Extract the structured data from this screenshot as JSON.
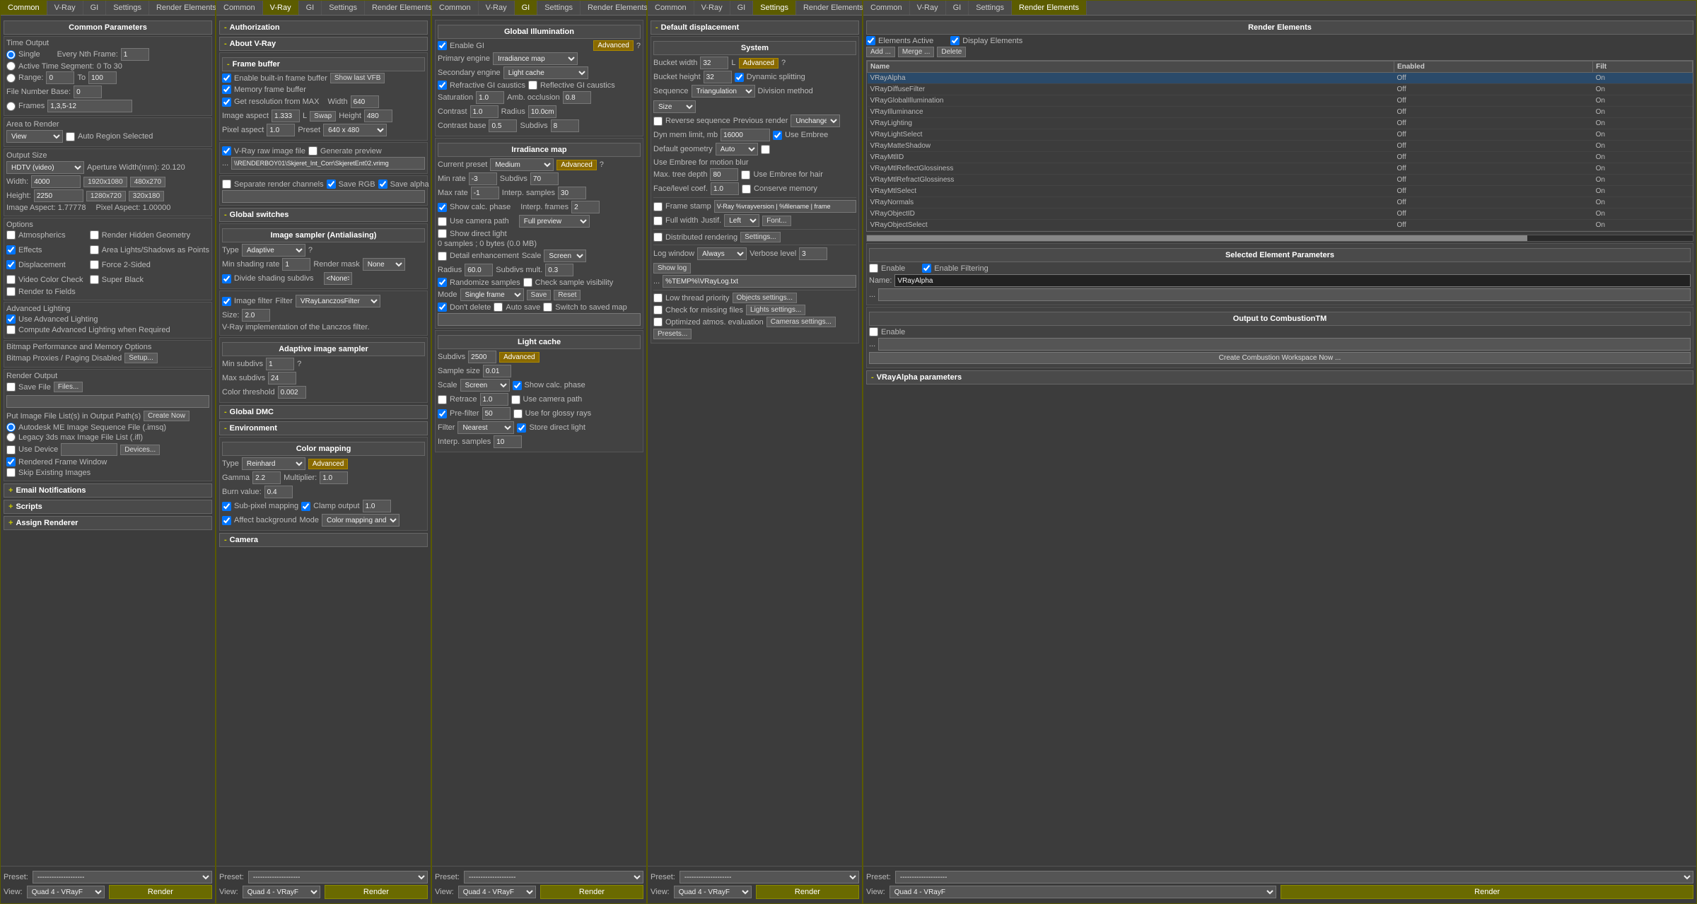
{
  "panels": [
    {
      "id": "panel1",
      "tabs": [
        "Common",
        "V-Ray",
        "GI",
        "Settings",
        "Render Elements"
      ],
      "activeTab": "Common",
      "sections": {
        "title": "Common Parameters",
        "timeOutput": {
          "label": "Time Output",
          "options": [
            {
              "label": "Single",
              "extra": "Every Nth Frame:",
              "value": "1"
            },
            {
              "label": "Active Time Segment:",
              "value": "0 To 30"
            },
            {
              "label": "Range:",
              "from": "0",
              "to": "100"
            },
            {
              "label": "File Number Base:",
              "value": "0"
            },
            {
              "label": "Frames",
              "value": "1,3,5-12"
            }
          ]
        },
        "areaToRender": {
          "label": "Area to Render",
          "view": "View",
          "autoRegion": "Auto Region Selected"
        },
        "outputSize": {
          "label": "Output Size",
          "preset": "HDTV (video)",
          "aperture": "Aperture Width(mm): 20.120",
          "width": "4000",
          "widthOptions": "1920x1080    480x270",
          "height": "2250",
          "heightOptions": "1280x720    320x180",
          "imageAspect": "1.77778",
          "pixelAspect": "1.00000"
        },
        "options": {
          "label": "Options",
          "items": [
            {
              "label": "Atmospherics",
              "checked": false
            },
            {
              "label": "Render Hidden Geometry",
              "checked": false
            },
            {
              "label": "Effects",
              "checked": true
            },
            {
              "label": "Area Lights/Shadows as Points",
              "checked": false
            },
            {
              "label": "Displacement",
              "checked": true
            },
            {
              "label": "Force 2-Sided",
              "checked": false
            },
            {
              "label": "Video Color Check",
              "checked": false
            },
            {
              "label": "Super Black",
              "checked": false
            },
            {
              "label": "Render to Fields",
              "checked": false
            }
          ]
        },
        "advancedLighting": {
          "label": "Advanced Lighting",
          "items": [
            {
              "label": "Use Advanced Lighting",
              "checked": true
            },
            {
              "label": "Compute Advanced Lighting when Required",
              "checked": false
            }
          ]
        },
        "bitmapPerf": {
          "label": "Bitmap Performance and Memory Options",
          "proxies": "Bitmap Proxies / Paging Disabled",
          "setupBtn": "Setup..."
        },
        "renderOutput": {
          "label": "Render Output",
          "saveFile": "Save File",
          "filesBtn": "Files...",
          "putImage": "Put Image File List(s) in Output Path(s)",
          "createNow": "Create Now",
          "autodesk": "Autodesk ME Image Sequence File (.imsq)",
          "legacy": "Legacy 3ds max Image File List (.ifl)",
          "useDevice": "Use Device",
          "devicesBtn": "Devices...",
          "renderedFrameWindow": "Rendered Frame Window",
          "skipExisting": "Skip Existing Images"
        },
        "email": "Email Notifications",
        "scripts": "Scripts",
        "assignRenderer": "Assign Renderer"
      },
      "footer": {
        "presetLabel": "Preset:",
        "presetValue": "--------------------",
        "viewLabel": "View:",
        "viewValue": "Quad 4 - VRayF",
        "renderBtn": "Render"
      }
    },
    {
      "id": "panel2",
      "tabs": [
        "Common",
        "V-Ray",
        "GI",
        "Settings",
        "Render Elements"
      ],
      "activeTab": "V-Ray",
      "sections": {
        "authorization": "Authorization",
        "aboutVRay": "About V-Ray",
        "frameBuffer": {
          "label": "Frame buffer",
          "items": [
            {
              "label": "Enable built-in frame buffer",
              "checked": true
            },
            {
              "label": "Memory frame buffer",
              "checked": true
            }
          ],
          "showLastVFB": "Show last VFB",
          "getResFromMax": "Get resolution from MAX",
          "widthLabel": "Width",
          "widthVal": "640",
          "heightLabel": "Height",
          "heightVal": "480",
          "swapBtn": "Swap",
          "imageAspect": "1.333",
          "pixelAspect": "1.0",
          "presetLabel": "Preset",
          "presetVal": "640 x 480",
          "lLabel": "L"
        },
        "rawImageFile": {
          "label": "V-Ray raw image file",
          "checked": true,
          "generatePreview": "Generate preview",
          "path": "\\\\RENDERBOY01\\Skjeret_Int_Corr\\SkjeretEnt02.vrimg"
        },
        "separateChannels": {
          "label": "Separate render channels",
          "checked": false,
          "saveRGB": "Save RGB",
          "saveAlpha": "Save alpha",
          "saveRGBChecked": true,
          "saveAlphaChecked": true
        },
        "globalSwitches": "Global switches",
        "imageSampler": {
          "label": "Image sampler (Antialiasing)",
          "typeLabel": "Type",
          "typeVal": "Adaptive",
          "minShadingRate": "1",
          "renderMask": "None",
          "divideShadingSubdivs": "Divide shading subdivs",
          "divideShadingSubdivsChecked": true,
          "noneVal": "<None>"
        },
        "imageFilter": {
          "label": "Image filter",
          "checked": true,
          "filterLabel": "Filter",
          "filterVal": "VRayLanczosFilter",
          "sizeLabel": "Size",
          "sizeVal": "2.0",
          "description": "V-Ray implementation of the Lanczos filter."
        },
        "adaptiveSampler": {
          "label": "Adaptive image sampler",
          "minSubdivs": "1",
          "maxSubdivs": "24",
          "colorThreshold": "0.002"
        },
        "globalDMC": "Global DMC",
        "environment": "Environment",
        "colorMapping": {
          "label": "Color mapping",
          "typeLabel": "Type",
          "typeVal": "Reinhard",
          "advancedBtn": "Advanced",
          "gammaLabel": "Gamma",
          "gammaVal": "2.2",
          "multiplierLabel": "Multiplier:",
          "multiplierVal": "1.0",
          "burnLabel": "Burn value:",
          "burnVal": "0.4",
          "subPixel": "Sub-pixel mapping",
          "subPixelChecked": true,
          "clampOutput": "Clamp output",
          "clampVal": "1.0",
          "affectBg": "Affect background",
          "affectBgChecked": true,
          "modeLabel": "Mode",
          "modeVal": "Color mapping and g"
        },
        "camera": "Camera"
      },
      "footer": {
        "presetLabel": "Preset:",
        "presetValue": "--------------------",
        "viewLabel": "View:",
        "viewValue": "Quad 4 - VRayF",
        "renderBtn": "Render"
      }
    },
    {
      "id": "panel3",
      "tabs": [
        "Common",
        "V-Ray",
        "GI",
        "Settings",
        "Render Elements"
      ],
      "activeTab": "GI",
      "sections": {
        "globalIllumination": {
          "label": "Global Illumination",
          "enableGI": "Enable GI",
          "enableGIChecked": true,
          "advancedBtn": "Advanced",
          "primaryLabel": "Primary engine",
          "primaryVal": "Irradiance map",
          "secondaryLabel": "Secondary engine",
          "secondaryVal": "Light cache",
          "refractiveGI": "Refractive GI caustics",
          "refractiveChecked": true,
          "reflectiveGI": "Reflective GI caustics",
          "reflectiveChecked": false,
          "saturationLabel": "Saturation",
          "saturationVal": "1.0",
          "ambOcclLabel": "Amb. occlusion",
          "ambOcclVal": "0.8",
          "contrastLabel": "Contrast",
          "contrastVal": "1.0",
          "radiusLabel": "Radius",
          "radiusVal": "10.0cm",
          "contrastBaseLabel": "Contrast base",
          "contrastBaseVal": "0.5",
          "subdivsLabel": "Subdivs",
          "subdivsVal": "8"
        },
        "irradianceMap": {
          "label": "Irradiance map",
          "currentPreset": "Medium",
          "advancedBtn": "Advanced",
          "minRate": "-3",
          "maxRate": "-1",
          "subdivs": "70",
          "interpSamples": "30",
          "showCalcPhase": "Show calc. phase",
          "showCalcPhaseChecked": true,
          "useCamera": "Use camera path",
          "useCameraChecked": false,
          "showDirect": "Show direct light",
          "showDirectChecked": false,
          "interpFrames": "2",
          "fullPreview": "Full preview",
          "bytes": "0 samples ; 0 bytes (0.0 MB)",
          "detailEnhancement": "Detail enhancement",
          "detailChecked": false,
          "scaleLabel": "Scale",
          "scaleVal": "Screen",
          "radiusLabel": "Radius",
          "radiusVal": "60.0",
          "subdivsMult": "Subdivs mult.",
          "subdivsMultVal": "0.3",
          "randomizeSamples": "Randomize samples",
          "randomizeChecked": true,
          "checkSampleVisibility": "Check sample visibility",
          "checkChecked": false,
          "mode": "Single frame",
          "saveBtn": "Save",
          "resetBtn": "Reset",
          "dontDelete": "Don't delete",
          "dontDeleteChecked": true,
          "autoSave": "Auto save",
          "autoSaveChecked": false,
          "switchToSaved": "Switch to saved map",
          "switchChecked": false
        },
        "lightCache": {
          "label": "Light cache",
          "subdivs": "2500",
          "advancedBtn": "Advanced",
          "sampleSize": "0.01",
          "scaleLabel": "Scale",
          "scaleVal": "Screen",
          "showCalcPhase": "Show calc. phase",
          "showCalcPhaseChecked": true,
          "retrace": "Retrace",
          "retraceChecked": false,
          "retraceVal": "1.0",
          "useCameraPath": "Use camera path",
          "useCameraPathChecked": false,
          "preFilter": "Pre-filter",
          "preFilterChecked": true,
          "preFilterVal": "50",
          "useGlossyRays": "Use for glossy rays",
          "useGlossyChecked": false,
          "filterLabel": "Filter",
          "filterVal": "Nearest",
          "storeDirect": "Store direct light",
          "storeDirectChecked": true,
          "interpSamples": "10"
        }
      },
      "footer": {
        "presetLabel": "Preset:",
        "presetValue": "--------------------",
        "viewLabel": "View:",
        "viewValue": "Quad 4 - VRayF",
        "renderBtn": "Render"
      }
    },
    {
      "id": "panel4",
      "tabs": [
        "Common",
        "V-Ray",
        "GI",
        "Settings",
        "Render Elements"
      ],
      "activeTab": "Settings",
      "sections": {
        "defaultDisplacement": {
          "label": "Default displacement",
          "system": "System",
          "bucketWidthLabel": "Bucket width",
          "bucketWidthVal": "32",
          "lLabel": "L",
          "advancedBtn": "Advanced",
          "bucketHeightLabel": "Bucket height",
          "bucketHeightVal": "32",
          "dynamicSplitting": "Dynamic splitting",
          "dynamicChecked": true,
          "sequenceLabel": "Sequence",
          "sequenceVal": "Triangulation",
          "divMethodLabel": "Division method",
          "divMethodVal": "Size",
          "reverseSeq": "Reverse sequence",
          "reverseChecked": false,
          "prevRender": "Previous render",
          "prevRenderVal": "Unchange",
          "dynMemLabel": "Dyn mem limit, mb",
          "dynMemVal": "16000",
          "useEmbree": "Use Embree",
          "useEmbreeChecked": true,
          "defaultGeom": "Default geometry",
          "defaultGeomVal": "Auto",
          "embreeMotionBlur": "Use Embree for motion blur",
          "embreeMotionChecked": false,
          "maxTreeDepth": "Max. tree depth",
          "maxTreeVal": "80",
          "embreeHair": "Use Embree for hair",
          "embreeHairChecked": false,
          "faceLevelCoef": "Face/level coef.",
          "faceLevelVal": "1.0",
          "conserveMemory": "Conserve memory",
          "conserveChecked": false,
          "frameStamp": "Frame stamp",
          "frameStampVal": "V-Ray %vrayversion | %filename | frame",
          "fullWidth": "Full width",
          "justify": "Justif.",
          "justifyVal": "Left",
          "fontBtn": "Font...",
          "distributedRendering": "Distributed rendering",
          "distributedChecked": false,
          "settingsBtn": "Settings...",
          "logWindow": "Log window",
          "logWindowVal": "Always",
          "verboseLevel": "Verbose level",
          "verboseLevelVal": "3",
          "showLog": "Show log",
          "logPath": "%TEMP%\\VRayLog.txt",
          "lowThreadPriority": "Low thread priority",
          "lowThreadChecked": false,
          "objectsSettings": "Objects settings...",
          "checkMissingFiles": "Check for missing files",
          "checkMissingChecked": false,
          "lightsSettings": "Lights settings...",
          "optimizedAtmos": "Optimized atmos. evaluation",
          "optimizedChecked": false,
          "camerasSettings": "Cameras settings...",
          "presetsBtn": "Presets..."
        }
      },
      "footer": {
        "presetLabel": "Preset:",
        "presetValue": "--------------------",
        "viewLabel": "View:",
        "viewValue": "Quad 4 - VRayF",
        "renderBtn": "Render"
      }
    },
    {
      "id": "panel5",
      "tabs": [
        "Common",
        "V-Ray",
        "GI",
        "Settings",
        "Render Elements"
      ],
      "activeTab": "Render Elements",
      "sections": {
        "renderElements": {
          "label": "Render Elements",
          "elementsActive": "Elements Active",
          "elementsActiveChecked": true,
          "displayElements": "Display Elements",
          "displayElementsChecked": true,
          "addBtn": "Add ...",
          "mergeBtn": "Merge ...",
          "deleteBtn": "Delete",
          "columns": [
            "Name",
            "Enabled",
            "Filt"
          ],
          "rows": [
            {
              "name": "VRayAlpha",
              "enabled": "Off",
              "filter": "On",
              "selected": true
            },
            {
              "name": "VRayDiffuseFilter",
              "enabled": "Off",
              "filter": "On",
              "selected": false
            },
            {
              "name": "VRayGlobalIllumination",
              "enabled": "Off",
              "filter": "On",
              "selected": false
            },
            {
              "name": "VRayIlluminance",
              "enabled": "Off",
              "filter": "On",
              "selected": false
            },
            {
              "name": "VRayLighting",
              "enabled": "Off",
              "filter": "On",
              "selected": false
            },
            {
              "name": "VRayLightSelect",
              "enabled": "Off",
              "filter": "On",
              "selected": false
            },
            {
              "name": "VRayMatteShadow",
              "enabled": "Off",
              "filter": "On",
              "selected": false
            },
            {
              "name": "VRayMtlID",
              "enabled": "Off",
              "filter": "On",
              "selected": false
            },
            {
              "name": "VRayMtlReflectGlossiness",
              "enabled": "Off",
              "filter": "On",
              "selected": false
            },
            {
              "name": "VRayMtlRefractGlossiness",
              "enabled": "Off",
              "filter": "On",
              "selected": false
            },
            {
              "name": "VRayMtlSelect",
              "enabled": "Off",
              "filter": "On",
              "selected": false
            },
            {
              "name": "VRayNormals",
              "enabled": "Off",
              "filter": "On",
              "selected": false
            },
            {
              "name": "VRayObjectID",
              "enabled": "Off",
              "filter": "On",
              "selected": false
            },
            {
              "name": "VRayObjectSelect",
              "enabled": "Off",
              "filter": "On",
              "selected": false
            }
          ],
          "selectedParams": {
            "label": "Selected Element Parameters",
            "enable": "Enable",
            "enableChecked": false,
            "enableFiltering": "Enable Filtering",
            "enableFilteringChecked": true,
            "nameLabel": "Name:",
            "nameVal": "VRayAlpha"
          },
          "outputToCombustion": {
            "label": "Output to CombustionTM",
            "enable": "Enable",
            "enableChecked": false
          },
          "createCombustion": "Create Combustion Workspace Now ...",
          "vrayAlphaParams": "VRayAlpha parameters"
        }
      },
      "footer": {
        "presetLabel": "Preset:",
        "presetValue": "--------------------",
        "viewLabel": "View:",
        "viewValue": "Quad 4 - VRayF",
        "renderBtn": "Render"
      }
    }
  ]
}
